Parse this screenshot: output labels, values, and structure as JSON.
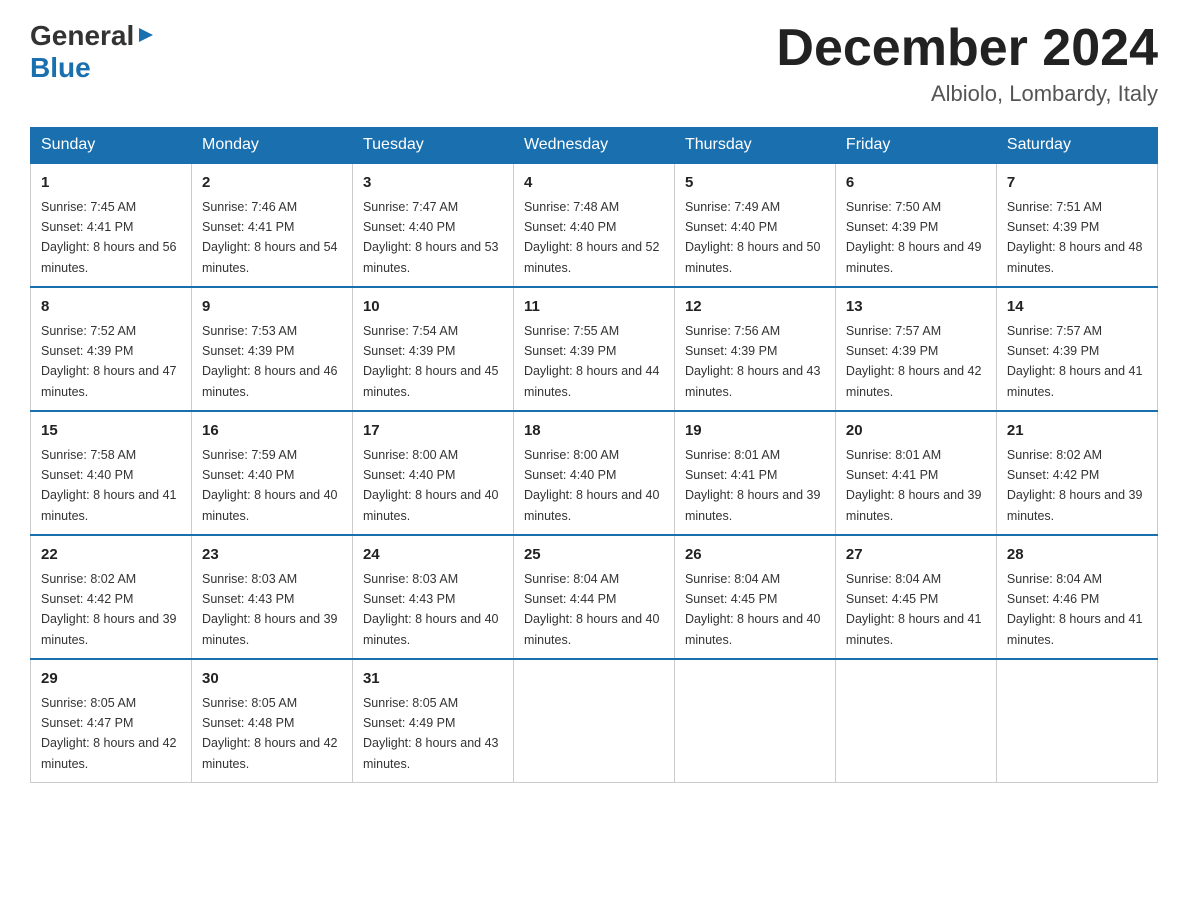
{
  "header": {
    "logo_general": "General",
    "logo_blue": "Blue",
    "title": "December 2024",
    "subtitle": "Albiolo, Lombardy, Italy"
  },
  "days_of_week": [
    "Sunday",
    "Monday",
    "Tuesday",
    "Wednesday",
    "Thursday",
    "Friday",
    "Saturday"
  ],
  "weeks": [
    [
      {
        "day": "1",
        "sunrise": "7:45 AM",
        "sunset": "4:41 PM",
        "daylight": "8 hours and 56 minutes."
      },
      {
        "day": "2",
        "sunrise": "7:46 AM",
        "sunset": "4:41 PM",
        "daylight": "8 hours and 54 minutes."
      },
      {
        "day": "3",
        "sunrise": "7:47 AM",
        "sunset": "4:40 PM",
        "daylight": "8 hours and 53 minutes."
      },
      {
        "day": "4",
        "sunrise": "7:48 AM",
        "sunset": "4:40 PM",
        "daylight": "8 hours and 52 minutes."
      },
      {
        "day": "5",
        "sunrise": "7:49 AM",
        "sunset": "4:40 PM",
        "daylight": "8 hours and 50 minutes."
      },
      {
        "day": "6",
        "sunrise": "7:50 AM",
        "sunset": "4:39 PM",
        "daylight": "8 hours and 49 minutes."
      },
      {
        "day": "7",
        "sunrise": "7:51 AM",
        "sunset": "4:39 PM",
        "daylight": "8 hours and 48 minutes."
      }
    ],
    [
      {
        "day": "8",
        "sunrise": "7:52 AM",
        "sunset": "4:39 PM",
        "daylight": "8 hours and 47 minutes."
      },
      {
        "day": "9",
        "sunrise": "7:53 AM",
        "sunset": "4:39 PM",
        "daylight": "8 hours and 46 minutes."
      },
      {
        "day": "10",
        "sunrise": "7:54 AM",
        "sunset": "4:39 PM",
        "daylight": "8 hours and 45 minutes."
      },
      {
        "day": "11",
        "sunrise": "7:55 AM",
        "sunset": "4:39 PM",
        "daylight": "8 hours and 44 minutes."
      },
      {
        "day": "12",
        "sunrise": "7:56 AM",
        "sunset": "4:39 PM",
        "daylight": "8 hours and 43 minutes."
      },
      {
        "day": "13",
        "sunrise": "7:57 AM",
        "sunset": "4:39 PM",
        "daylight": "8 hours and 42 minutes."
      },
      {
        "day": "14",
        "sunrise": "7:57 AM",
        "sunset": "4:39 PM",
        "daylight": "8 hours and 41 minutes."
      }
    ],
    [
      {
        "day": "15",
        "sunrise": "7:58 AM",
        "sunset": "4:40 PM",
        "daylight": "8 hours and 41 minutes."
      },
      {
        "day": "16",
        "sunrise": "7:59 AM",
        "sunset": "4:40 PM",
        "daylight": "8 hours and 40 minutes."
      },
      {
        "day": "17",
        "sunrise": "8:00 AM",
        "sunset": "4:40 PM",
        "daylight": "8 hours and 40 minutes."
      },
      {
        "day": "18",
        "sunrise": "8:00 AM",
        "sunset": "4:40 PM",
        "daylight": "8 hours and 40 minutes."
      },
      {
        "day": "19",
        "sunrise": "8:01 AM",
        "sunset": "4:41 PM",
        "daylight": "8 hours and 39 minutes."
      },
      {
        "day": "20",
        "sunrise": "8:01 AM",
        "sunset": "4:41 PM",
        "daylight": "8 hours and 39 minutes."
      },
      {
        "day": "21",
        "sunrise": "8:02 AM",
        "sunset": "4:42 PM",
        "daylight": "8 hours and 39 minutes."
      }
    ],
    [
      {
        "day": "22",
        "sunrise": "8:02 AM",
        "sunset": "4:42 PM",
        "daylight": "8 hours and 39 minutes."
      },
      {
        "day": "23",
        "sunrise": "8:03 AM",
        "sunset": "4:43 PM",
        "daylight": "8 hours and 39 minutes."
      },
      {
        "day": "24",
        "sunrise": "8:03 AM",
        "sunset": "4:43 PM",
        "daylight": "8 hours and 40 minutes."
      },
      {
        "day": "25",
        "sunrise": "8:04 AM",
        "sunset": "4:44 PM",
        "daylight": "8 hours and 40 minutes."
      },
      {
        "day": "26",
        "sunrise": "8:04 AM",
        "sunset": "4:45 PM",
        "daylight": "8 hours and 40 minutes."
      },
      {
        "day": "27",
        "sunrise": "8:04 AM",
        "sunset": "4:45 PM",
        "daylight": "8 hours and 41 minutes."
      },
      {
        "day": "28",
        "sunrise": "8:04 AM",
        "sunset": "4:46 PM",
        "daylight": "8 hours and 41 minutes."
      }
    ],
    [
      {
        "day": "29",
        "sunrise": "8:05 AM",
        "sunset": "4:47 PM",
        "daylight": "8 hours and 42 minutes."
      },
      {
        "day": "30",
        "sunrise": "8:05 AM",
        "sunset": "4:48 PM",
        "daylight": "8 hours and 42 minutes."
      },
      {
        "day": "31",
        "sunrise": "8:05 AM",
        "sunset": "4:49 PM",
        "daylight": "8 hours and 43 minutes."
      },
      null,
      null,
      null,
      null
    ]
  ]
}
